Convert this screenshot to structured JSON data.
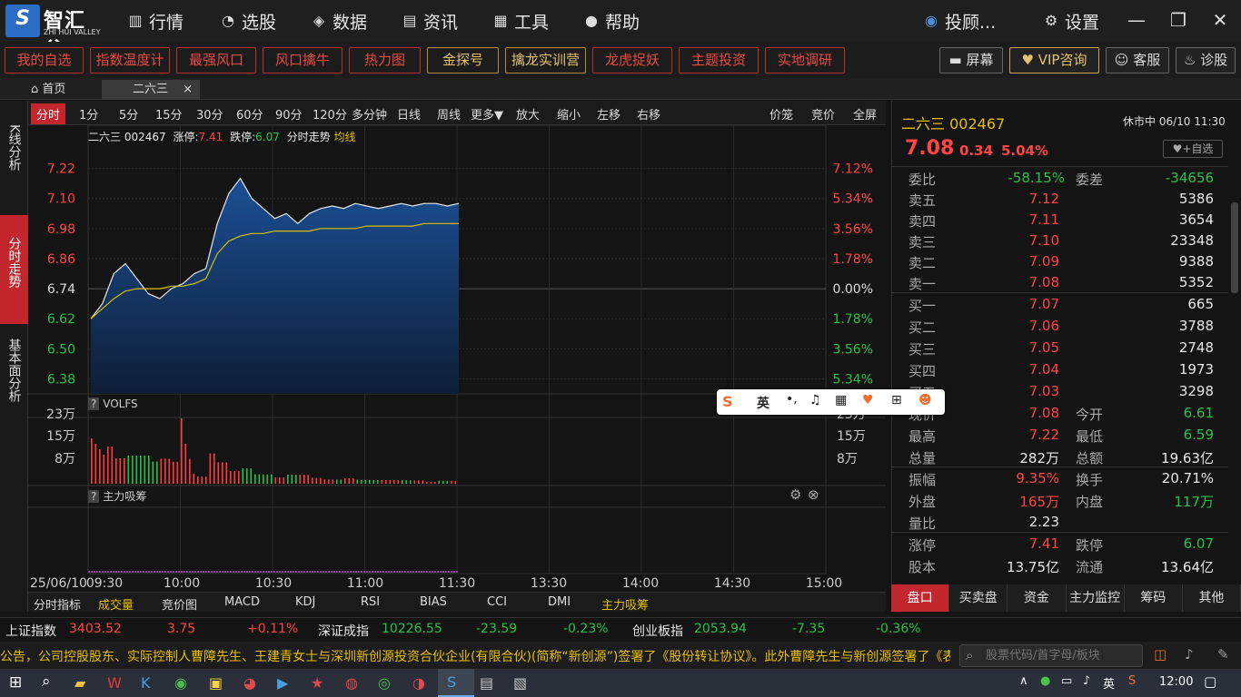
{
  "app": {
    "logo_text": "智汇谷",
    "logo_sub": "ZHI HUI VALLEY",
    "logo_glyph": "S"
  },
  "nav": [
    {
      "label": "行情",
      "icon": "bar-chart-icon"
    },
    {
      "label": "选股",
      "icon": "gauge-icon"
    },
    {
      "label": "数据",
      "icon": "layers-icon"
    },
    {
      "label": "资讯",
      "icon": "news-icon"
    },
    {
      "label": "工具",
      "icon": "grid-icon"
    },
    {
      "label": "帮助",
      "icon": "bulb-icon"
    }
  ],
  "header_right": {
    "user": "投顾...",
    "settings": "设置"
  },
  "toolbar": {
    "buttons": [
      "我的自选",
      "指数温度计",
      "最强风口",
      "风口擒牛",
      "热力图"
    ],
    "gold": [
      "金探号",
      "擒龙实训营",
      "龙虎捉妖",
      "主题投资",
      "实地调研"
    ],
    "right": [
      "屏幕",
      "VIP咨询",
      "客服",
      "诊股"
    ]
  },
  "tabs": {
    "home": "首页",
    "stock": "二六三",
    "close": "×"
  },
  "left_side": {
    "k": "K线分析",
    "fs": "分时走势",
    "jb": "基本面分析"
  },
  "periods": [
    "分时",
    "1分",
    "5分",
    "15分",
    "30分",
    "60分",
    "90分",
    "120分",
    "多分钟",
    "日线",
    "周线",
    "更多▼",
    "放大",
    "缩小",
    "左移",
    "右移"
  ],
  "period_right": [
    "价笼",
    "竞价",
    "全屏"
  ],
  "chart_info": {
    "name": "二六三",
    "code": "002467",
    "zt_label": "涨停:",
    "zt": "7.41",
    "dt_label": "跌停:",
    "dt": "6.07",
    "mode": "分时走势",
    "avg": "均线"
  },
  "chart_data": {
    "type": "line",
    "title": "二六三 002467 分时走势",
    "prev_close": 6.74,
    "ylabels_left": [
      "7.22",
      "7.10",
      "6.98",
      "6.86",
      "6.74",
      "6.62",
      "6.50",
      "6.38"
    ],
    "ylabels_right": [
      "7.12%",
      "5.34%",
      "3.56%",
      "1.78%",
      "0.00%",
      "1.78%",
      "3.56%",
      "5.34%"
    ],
    "xlabels": [
      "25/06/10",
      "09:30",
      "10:00",
      "10:30",
      "11:00",
      "11:30",
      "13:30",
      "14:00",
      "14:30",
      "15:00"
    ],
    "series": [
      {
        "name": "价格",
        "values": [
          6.62,
          6.68,
          6.8,
          6.84,
          6.78,
          6.72,
          6.7,
          6.74,
          6.76,
          6.8,
          6.82,
          7.0,
          7.12,
          7.18,
          7.1,
          7.06,
          7.02,
          7.04,
          7.0,
          7.04,
          7.06,
          7.07,
          7.06,
          7.08,
          7.07,
          7.06,
          7.07,
          7.08,
          7.07,
          7.08,
          7.08,
          7.07,
          7.08
        ]
      },
      {
        "name": "均线",
        "values": [
          6.62,
          6.66,
          6.7,
          6.73,
          6.74,
          6.74,
          6.74,
          6.75,
          6.75,
          6.76,
          6.78,
          6.88,
          6.93,
          6.95,
          6.96,
          6.96,
          6.97,
          6.97,
          6.97,
          6.97,
          6.98,
          6.98,
          6.98,
          6.98,
          6.99,
          6.99,
          6.99,
          6.99,
          6.99,
          7.0,
          7.0,
          7.0,
          7.0
        ]
      }
    ],
    "volume": {
      "label": "VOLFS",
      "ylabels": [
        "23万",
        "15万",
        "8万"
      ]
    },
    "sub": {
      "label": "主力吸筹"
    }
  },
  "indicators": [
    "分时指标",
    "成交量",
    "竞价图",
    "MACD",
    "KDJ",
    "RSI",
    "BIAS",
    "CCI",
    "DMI",
    "主力吸筹"
  ],
  "quote": {
    "name": "二六三",
    "code": "002467",
    "status": "休市中 06/10 11:30",
    "price": "7.08",
    "chg": "0.34",
    "pct": "5.04%",
    "fav": "+自选",
    "wb_label": "委比",
    "wb": "-58.15%",
    "wc_label": "委差",
    "wc": "-34656",
    "asks": [
      {
        "l": "卖五",
        "p": "7.12",
        "v": "5386"
      },
      {
        "l": "卖四",
        "p": "7.11",
        "v": "3654"
      },
      {
        "l": "卖三",
        "p": "7.10",
        "v": "23348"
      },
      {
        "l": "卖二",
        "p": "7.09",
        "v": "9388"
      },
      {
        "l": "卖一",
        "p": "7.08",
        "v": "5352"
      }
    ],
    "bids": [
      {
        "l": "买一",
        "p": "7.07",
        "v": "665"
      },
      {
        "l": "买二",
        "p": "7.06",
        "v": "3788"
      },
      {
        "l": "买三",
        "p": "7.05",
        "v": "2748"
      },
      {
        "l": "买四",
        "p": "7.04",
        "v": "1973"
      },
      {
        "l": "买五",
        "p": "7.03",
        "v": "3298"
      }
    ],
    "stats": [
      [
        "现价",
        "7.08",
        "今开",
        "6.61"
      ],
      [
        "最高",
        "7.22",
        "最低",
        "6.59"
      ],
      [
        "总量",
        "282万",
        "总额",
        "19.63亿"
      ],
      [
        "振幅",
        "9.35%",
        "换手",
        "20.71%"
      ],
      [
        "外盘",
        "165万",
        "内盘",
        "117万"
      ],
      [
        "量比",
        "2.23",
        "",
        ""
      ],
      [
        "涨停",
        "7.41",
        "跌停",
        "6.07"
      ],
      [
        "股本",
        "13.75亿",
        "流通",
        "13.64亿"
      ]
    ]
  },
  "rp_tabs": [
    "盘口",
    "买卖盘",
    "资金",
    "主力监控",
    "筹码",
    "其他"
  ],
  "indexes": [
    {
      "name": "上证指数",
      "val": "3403.52",
      "chg": "3.75",
      "pct": "+0.11%"
    },
    {
      "name": "深证成指",
      "val": "10226.55",
      "chg": "-23.59",
      "pct": "-0.23%"
    },
    {
      "name": "创业板指",
      "val": "2053.94",
      "chg": "-7.35",
      "pct": "-0.36%"
    }
  ],
  "news": "公告，公司控股股东、实际控制人曹障先生、王建青女士与深圳新创源投资合伙企业(有限合伙)(简称“新创源”)签署了《股份转让协议》。此外曹障先生与新创源签署了《表",
  "search_placeholder": "股票代码/首字母/板块",
  "ime": {
    "lang": "英"
  },
  "taskbar": {
    "time": "12:00",
    "lang": "英"
  }
}
